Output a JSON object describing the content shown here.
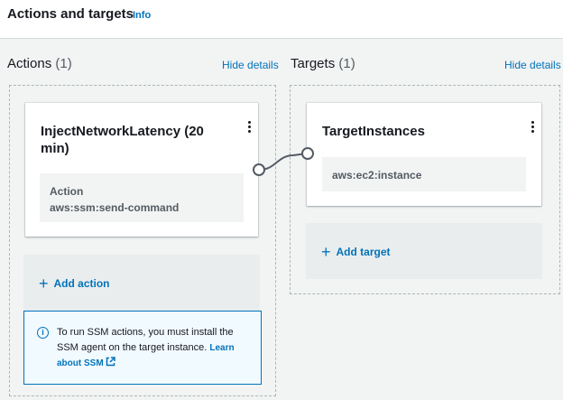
{
  "header": {
    "title": "Actions and targets",
    "info_label": "Info"
  },
  "actions": {
    "title": "Actions",
    "count": "(1)",
    "hide_details": "Hide details",
    "card": {
      "title": "InjectNetworkLatency (20 min)",
      "detail_label": "Action",
      "detail_value": "aws:ssm:send-command"
    },
    "add_label": "Add action",
    "alert": {
      "text": "To run SSM actions, you must install the SSM agent on the target instance.",
      "link": "Learn about SSM"
    }
  },
  "targets": {
    "title": "Targets",
    "count": "(1)",
    "hide_details": "Hide details",
    "card": {
      "title": "TargetInstances",
      "detail_value": "aws:ec2:instance"
    },
    "add_label": "Add target"
  },
  "colors": {
    "link": "#0073bb",
    "border": "#aab7b8",
    "background": "#f2f3f3"
  },
  "icons": [
    "kebab-menu-icon",
    "plus-icon",
    "info-circle-icon",
    "external-link-icon"
  ]
}
